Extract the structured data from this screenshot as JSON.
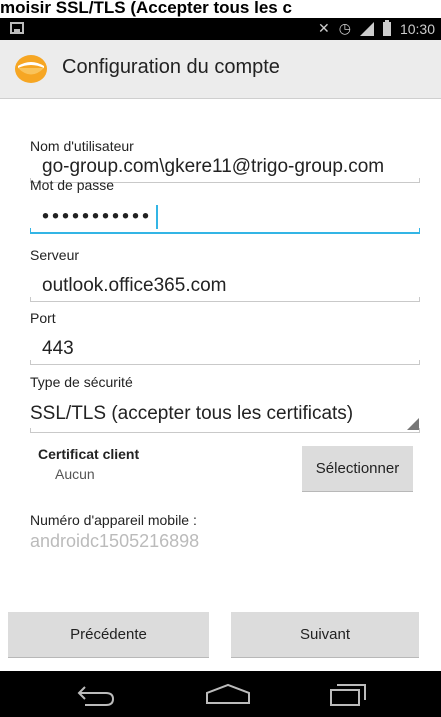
{
  "top_caption": "moisir SSL/TLS (Accepter tous les c",
  "status_bar": {
    "time": "10:30",
    "icons": [
      "notification-icon",
      "mute-icon",
      "alarm-icon",
      "signal-icon",
      "battery-icon"
    ]
  },
  "action_bar": {
    "title": "Configuration du compte",
    "icon": "email-app-icon"
  },
  "form": {
    "username_label": "Nom d'utilisateur",
    "username_value": "go-group.com\\gkere11@trigo-group.com",
    "password_label": "Mot de passe",
    "password_value": "•••••••••••",
    "server_label": "Serveur",
    "server_value": "outlook.office365.com",
    "port_label": "Port",
    "port_value": "443",
    "security_label": "Type de sécurité",
    "security_value": "SSL/TLS (accepter tous les certificats)",
    "client_cert_label": "Certificat client",
    "client_cert_value": "Aucun",
    "select_button": "Sélectionner",
    "device_label": "Numéro d'appareil mobile :",
    "device_value": "androidc1505216898"
  },
  "footer": {
    "previous_button": "Précédente",
    "next_button": "Suivant"
  },
  "navigation": {
    "icons": [
      "back-icon",
      "home-icon",
      "recent-apps-icon"
    ]
  },
  "colors": {
    "accent": "#33b5e5",
    "action_bar": "#ececec",
    "button": "#dcdcdc",
    "status_bar": "#000000"
  }
}
